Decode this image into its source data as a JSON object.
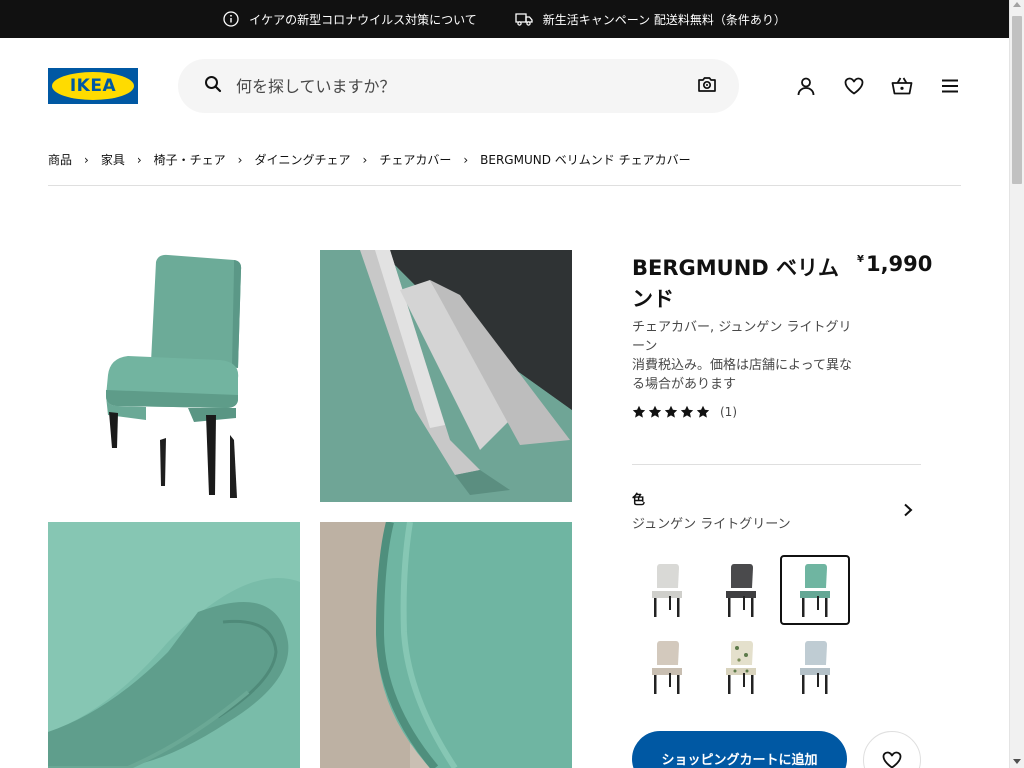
{
  "topbar": {
    "notice_text": "イケアの新型コロナウイルス対策について",
    "campaign_text": "新生活キャンペーン 配送料無料（条件あり）"
  },
  "header": {
    "logo_text": "IKEA",
    "search_placeholder": "何を探していますか？",
    "icons": [
      "user-icon",
      "heart-icon",
      "cart-icon",
      "menu-icon"
    ]
  },
  "breadcrumb": {
    "items": [
      "商品",
      "家具",
      "椅子・チェア",
      "ダイニングチェア",
      "チェアカバー",
      "BERGMUND ベリムンド チェアカバー"
    ]
  },
  "product": {
    "name": "BERGMUND ベリムンド",
    "price_symbol": "¥",
    "price": "1,990",
    "description": "チェアカバー, ジュンゲン ライトグリーン",
    "price_note": "消費税込み。価格は店舗によって異なる場合があります",
    "rating_stars": 5,
    "rating_count": "(1)"
  },
  "color": {
    "label": "色",
    "value": "ジュンゲン ライトグリーン",
    "options": [
      {
        "color": "#d9d9d6",
        "selected": false
      },
      {
        "color": "#4a4a4c",
        "selected": false
      },
      {
        "color": "#6fb9a4",
        "selected": true
      },
      {
        "color": "#cfc6ba",
        "selected": false
      },
      {
        "color": "#dcd8c4",
        "selected": false
      },
      {
        "color": "#b8c5cc",
        "selected": false
      }
    ]
  },
  "actions": {
    "add_to_cart": "ショッピングカートに追加"
  },
  "colors": {
    "accent": "#0058a3",
    "logo_yellow": "#ffdb00",
    "topbar_bg": "#111111"
  }
}
